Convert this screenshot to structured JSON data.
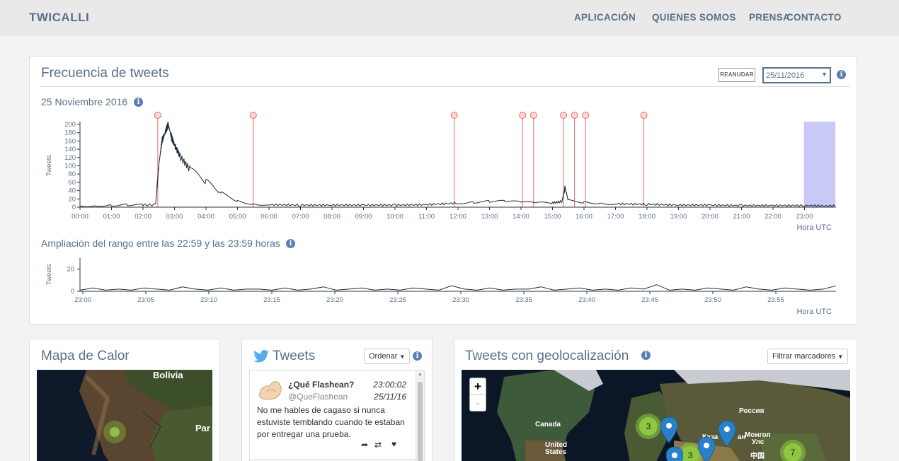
{
  "nav": {
    "brand": "TWICALLI",
    "links": [
      "APLICACIÓN",
      "QUIENES SOMOS",
      "PRENSA",
      "CONTACTO"
    ]
  },
  "freq": {
    "title": "Frecuencia de tweets",
    "resume_label": "REANUDAR",
    "date_value": "25/11/2016",
    "date_label": "25 Noviembre 2016",
    "ylabel": "Tweets",
    "xunit": "Hora UTC",
    "zoom_title": "Ampliación del rango entre las 22:59 y las 23:59 horas",
    "zoom_ylabel": "Tweets",
    "zoom_xunit": "Hora UTC"
  },
  "chart_data": [
    {
      "type": "line",
      "title": "25 Noviembre 2016",
      "ylabel": "Tweets",
      "xlabel": "Hora UTC",
      "ylim": [
        0,
        200
      ],
      "yticks": [
        0,
        20,
        40,
        60,
        80,
        100,
        120,
        140,
        160,
        180,
        200
      ],
      "xticks": [
        "00:00",
        "01:00",
        "02:00",
        "03:00",
        "04:00",
        "05:00",
        "06:00",
        "07:00",
        "08:00",
        "09:00",
        "10:00",
        "11:00",
        "12:00",
        "13:00",
        "14:00",
        "15:00",
        "16:00",
        "17:00",
        "18:00",
        "19:00",
        "20:00",
        "21:00",
        "22:00",
        "23:00"
      ],
      "x_hours": [
        0,
        0.5,
        1,
        1.5,
        2,
        2.4,
        2.5,
        2.6,
        2.7,
        2.8,
        2.9,
        3.0,
        3.2,
        3.5,
        4.0,
        4.5,
        5.0,
        5.5,
        6,
        7,
        8,
        9,
        10,
        11,
        12,
        12.5,
        13,
        13.5,
        14,
        14.5,
        15,
        15.3,
        15.4,
        15.5,
        16,
        16.5,
        17,
        18,
        19,
        20,
        21,
        22,
        23,
        23.98
      ],
      "series": [
        {
          "values": [
            3,
            4,
            5,
            6,
            5,
            6,
            100,
            160,
            180,
            200,
            170,
            150,
            120,
            90,
            60,
            35,
            15,
            8,
            6,
            5,
            5,
            5,
            5,
            6,
            10,
            12,
            14,
            14,
            12,
            10,
            10,
            14,
            48,
            16,
            12,
            10,
            8,
            7,
            5,
            5,
            4,
            4,
            4,
            3
          ]
        }
      ],
      "event_markers_hours": [
        2.47,
        5.5,
        11.88,
        14.05,
        14.4,
        15.35,
        15.7,
        16.05,
        17.9
      ],
      "highlight_range_hours": [
        22.98,
        23.98
      ]
    },
    {
      "type": "line",
      "title": "Ampliación del rango entre las 22:59 y las 23:59 horas",
      "ylabel": "Tweets",
      "xlabel": "Hora UTC",
      "ylim": [
        0,
        30
      ],
      "yticks": [
        0,
        20
      ],
      "xticks": [
        "23:00",
        "23:05",
        "23:10",
        "23:15",
        "23:20",
        "23:25",
        "23:30",
        "23:35",
        "23:40",
        "23:45",
        "23:50",
        "23:55"
      ],
      "series": [
        {
          "values": [
            1,
            3,
            1,
            2,
            1,
            3,
            2,
            1,
            4,
            2,
            1,
            3,
            1,
            2,
            2,
            1,
            3,
            1,
            2,
            4,
            1,
            2,
            3,
            1,
            2,
            1,
            3,
            2,
            1,
            5,
            2,
            1,
            3,
            1,
            2,
            2,
            4,
            1,
            2,
            3,
            1,
            2,
            1,
            3,
            2,
            6,
            1,
            2,
            1,
            3,
            2,
            1,
            4,
            2,
            1,
            3,
            2,
            1,
            2,
            5
          ]
        }
      ]
    }
  ],
  "heatmap": {
    "title": "Mapa de Calor",
    "labels": [
      "Bolivia",
      "Par"
    ]
  },
  "tweets": {
    "title": "Tweets",
    "order_label": "Ordenar",
    "items": [
      {
        "name": "¿Qué Flashean?",
        "handle": "@QueFlashean",
        "time": "23:00:02",
        "date": "25/11/16",
        "text": "No me hables de cagaso si nunca estuviste temblando cuando te estaban por entregar una prueba."
      }
    ]
  },
  "geo": {
    "title": "Tweets con geolocalización",
    "filter_label": "Filtrar marcadores",
    "zoom_in": "+",
    "zoom_out": "-",
    "labels": [
      "Россия",
      "Canada",
      "United",
      "States",
      "Монгол",
      "Улс",
      "Каза",
      "ан",
      "中国"
    ],
    "clusters": [
      "3",
      "3",
      "7"
    ]
  }
}
